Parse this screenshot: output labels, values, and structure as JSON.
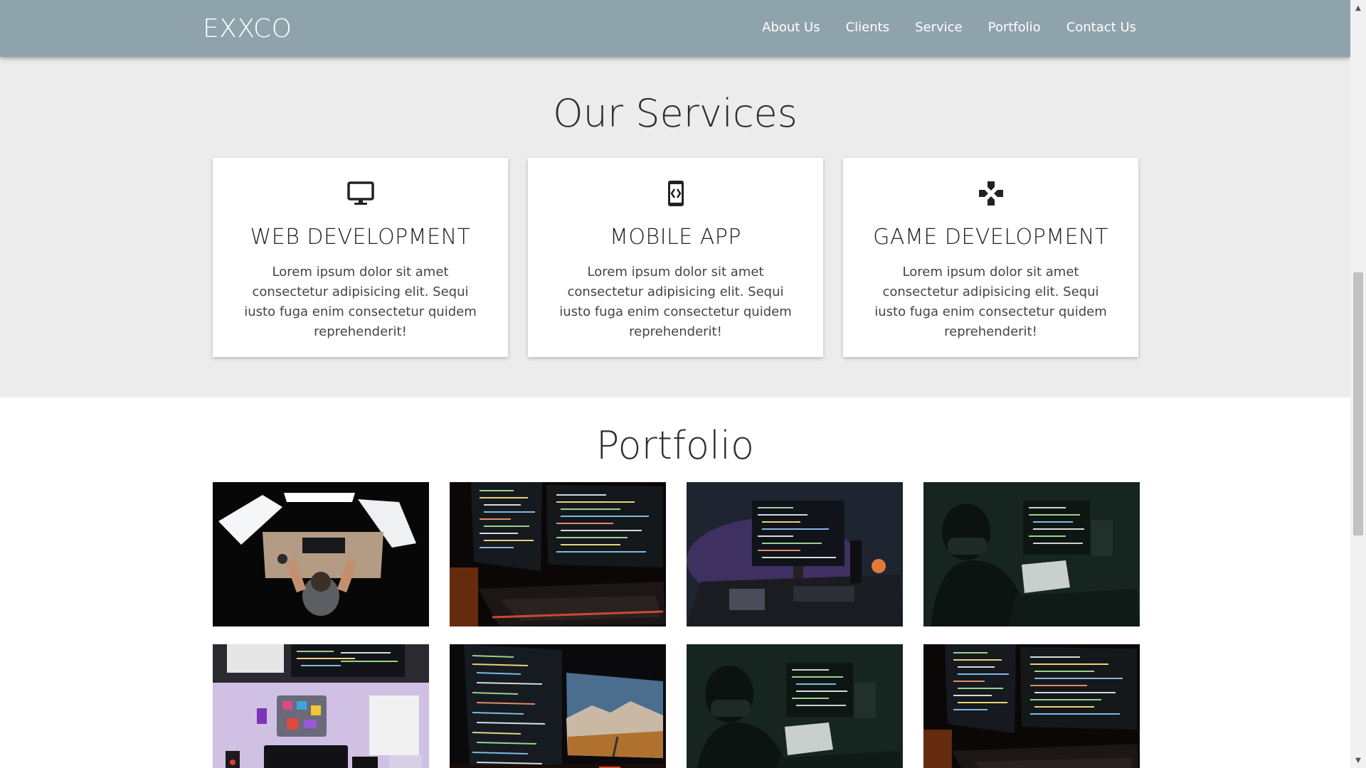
{
  "navbar": {
    "brand": "EXXCO",
    "links": [
      "About Us",
      "Clients",
      "Service",
      "Portfolio",
      "Contact Us"
    ]
  },
  "services": {
    "title": "Our Services",
    "cards": [
      {
        "icon": "desktop-icon",
        "title": "WEB DEVELOPMENT",
        "text": "Lorem ipsum dolor sit amet consectetur adipisicing elit. Sequi iusto fuga enim consectetur quidem reprehenderit!"
      },
      {
        "icon": "mobile-code-icon",
        "title": "MOBILE APP",
        "text": "Lorem ipsum dolor sit amet consectetur adipisicing elit. Sequi iusto fuga enim consectetur quidem reprehenderit!"
      },
      {
        "icon": "gamepad-icon",
        "title": "GAME DEVELOPMENT",
        "text": "Lorem ipsum dolor sit amet consectetur adipisicing elit. Sequi iusto fuga enim consectetur quidem reprehenderit!"
      }
    ]
  },
  "portfolio": {
    "title": "Portfolio",
    "images": [
      "overhead-desk-photo",
      "code-monitors-orange-glow-photo",
      "purple-monitor-setup-photo",
      "developer-dark-room-photo",
      "purple-desk-overhead-photo",
      "dual-monitor-landscape-photo",
      "developer-dark-room-photo",
      "code-monitors-orange-glow-photo"
    ]
  }
}
